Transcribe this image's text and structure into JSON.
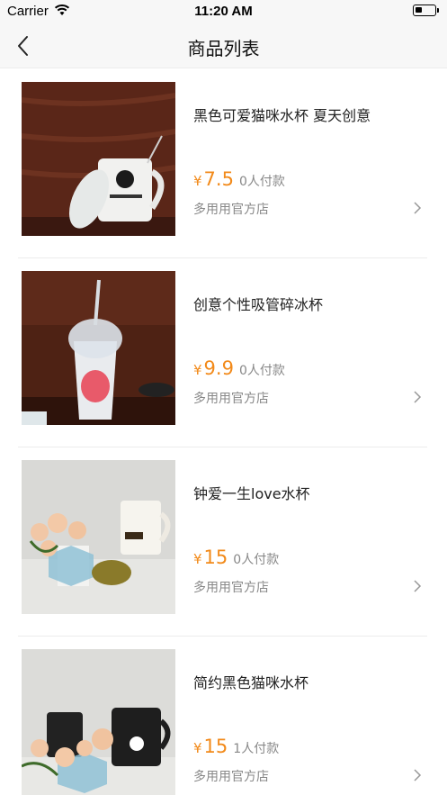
{
  "status": {
    "carrier": "Carrier",
    "time": "11:20 AM"
  },
  "nav": {
    "title": "商品列表"
  },
  "products": [
    {
      "name": "黑色可爱猫咪水杯 夏天创意",
      "currency": "¥",
      "price": "7.5",
      "paid": "0人付款",
      "shop": "多用用官方店"
    },
    {
      "name": "创意个性吸管碎冰杯",
      "currency": "¥",
      "price": "9.9",
      "paid": "0人付款",
      "shop": "多用用官方店"
    },
    {
      "name": "钟爱一生love水杯",
      "currency": "¥",
      "price": "15",
      "paid": "0人付款",
      "shop": "多用用官方店"
    },
    {
      "name": "简约黑色猫咪水杯",
      "currency": "¥",
      "price": "15",
      "paid": "1人付款",
      "shop": "多用用官方店"
    }
  ],
  "colors": {
    "price": "#f28a1a",
    "secondary_text": "#888888",
    "nav_bg": "#f7f7f7"
  }
}
